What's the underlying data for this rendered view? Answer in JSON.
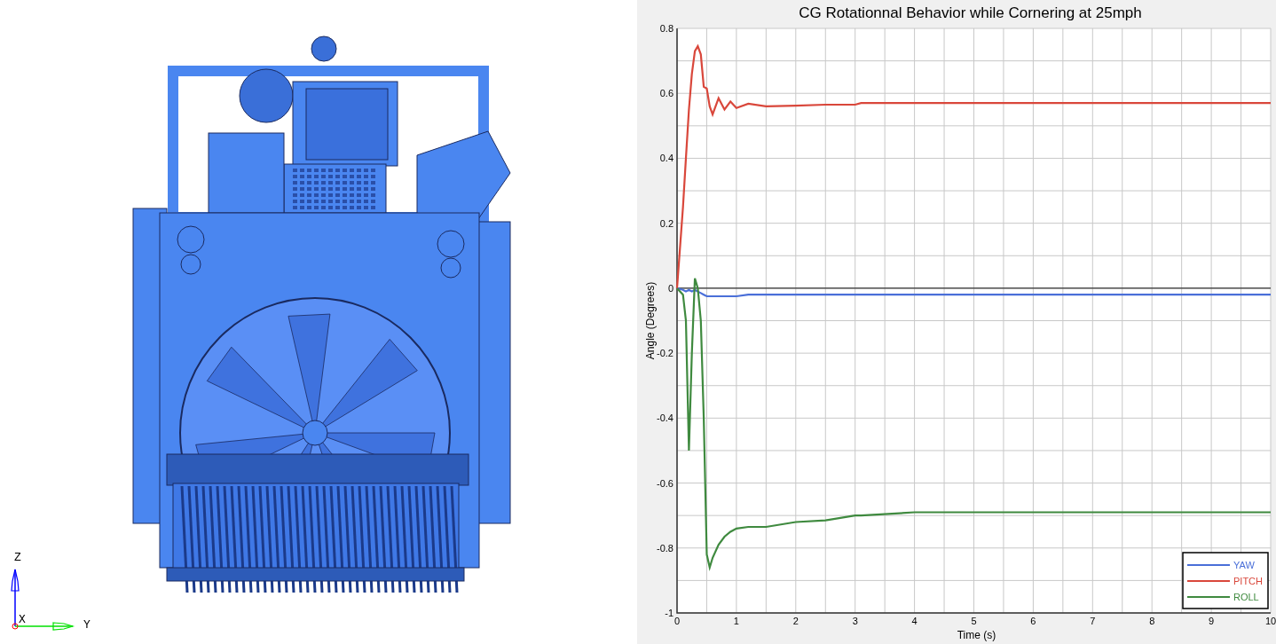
{
  "viewport": {
    "triad": {
      "z_label": "Z",
      "x_label": "X",
      "y_label": "Y"
    }
  },
  "plot": {
    "chart_data": {
      "type": "line",
      "title": "CG Rotationnal Behavior while Cornering at 25mph",
      "xlabel": "Time (s)",
      "ylabel": "Angle (Degrees)",
      "x": [
        0,
        0.1,
        0.15,
        0.2,
        0.25,
        0.3,
        0.35,
        0.4,
        0.45,
        0.5,
        0.55,
        0.6,
        0.7,
        0.8,
        0.9,
        1,
        1.2,
        1.5,
        2,
        2.5,
        3,
        3.1,
        4,
        5,
        6,
        7,
        8,
        9,
        10
      ],
      "series": [
        {
          "name": "YAW",
          "color": "#4a6fd8",
          "values": [
            0,
            -0.005,
            -0.01,
            -0.005,
            -0.01,
            -0.005,
            -0.01,
            -0.015,
            -0.02,
            -0.025,
            -0.025,
            -0.025,
            -0.025,
            -0.025,
            -0.025,
            -0.025,
            -0.02,
            -0.02,
            -0.02,
            -0.02,
            -0.02,
            -0.02,
            -0.02,
            -0.02,
            -0.02,
            -0.02,
            -0.02,
            -0.02,
            -0.02
          ]
        },
        {
          "name": "PITCH",
          "color": "#d9473b",
          "values": [
            0,
            0.25,
            0.4,
            0.55,
            0.66,
            0.73,
            0.745,
            0.72,
            0.62,
            0.615,
            0.56,
            0.535,
            0.585,
            0.55,
            0.575,
            0.555,
            0.568,
            0.56,
            0.562,
            0.565,
            0.565,
            0.57,
            0.57,
            0.57,
            0.57,
            0.57,
            0.57,
            0.57,
            0.57
          ]
        },
        {
          "name": "ROLL",
          "color": "#3f8a3f",
          "values": [
            0,
            -0.02,
            -0.1,
            -0.5,
            -0.2,
            0.03,
            0,
            -0.1,
            -0.4,
            -0.82,
            -0.86,
            -0.83,
            -0.79,
            -0.765,
            -0.75,
            -0.74,
            -0.735,
            -0.735,
            -0.72,
            -0.715,
            -0.7,
            -0.7,
            -0.69,
            -0.69,
            -0.69,
            -0.69,
            -0.69,
            -0.69,
            -0.69
          ]
        }
      ],
      "xlim": [
        0,
        10
      ],
      "ylim": [
        -1,
        0.8
      ],
      "grid": true,
      "legend": true,
      "xticks": [
        0,
        1,
        2,
        3,
        4,
        5,
        6,
        7,
        8,
        9,
        10
      ],
      "yticks": [
        -1,
        -0.8,
        -0.6,
        -0.4,
        -0.2,
        0,
        0.2,
        0.4,
        0.6,
        0.8
      ]
    }
  }
}
